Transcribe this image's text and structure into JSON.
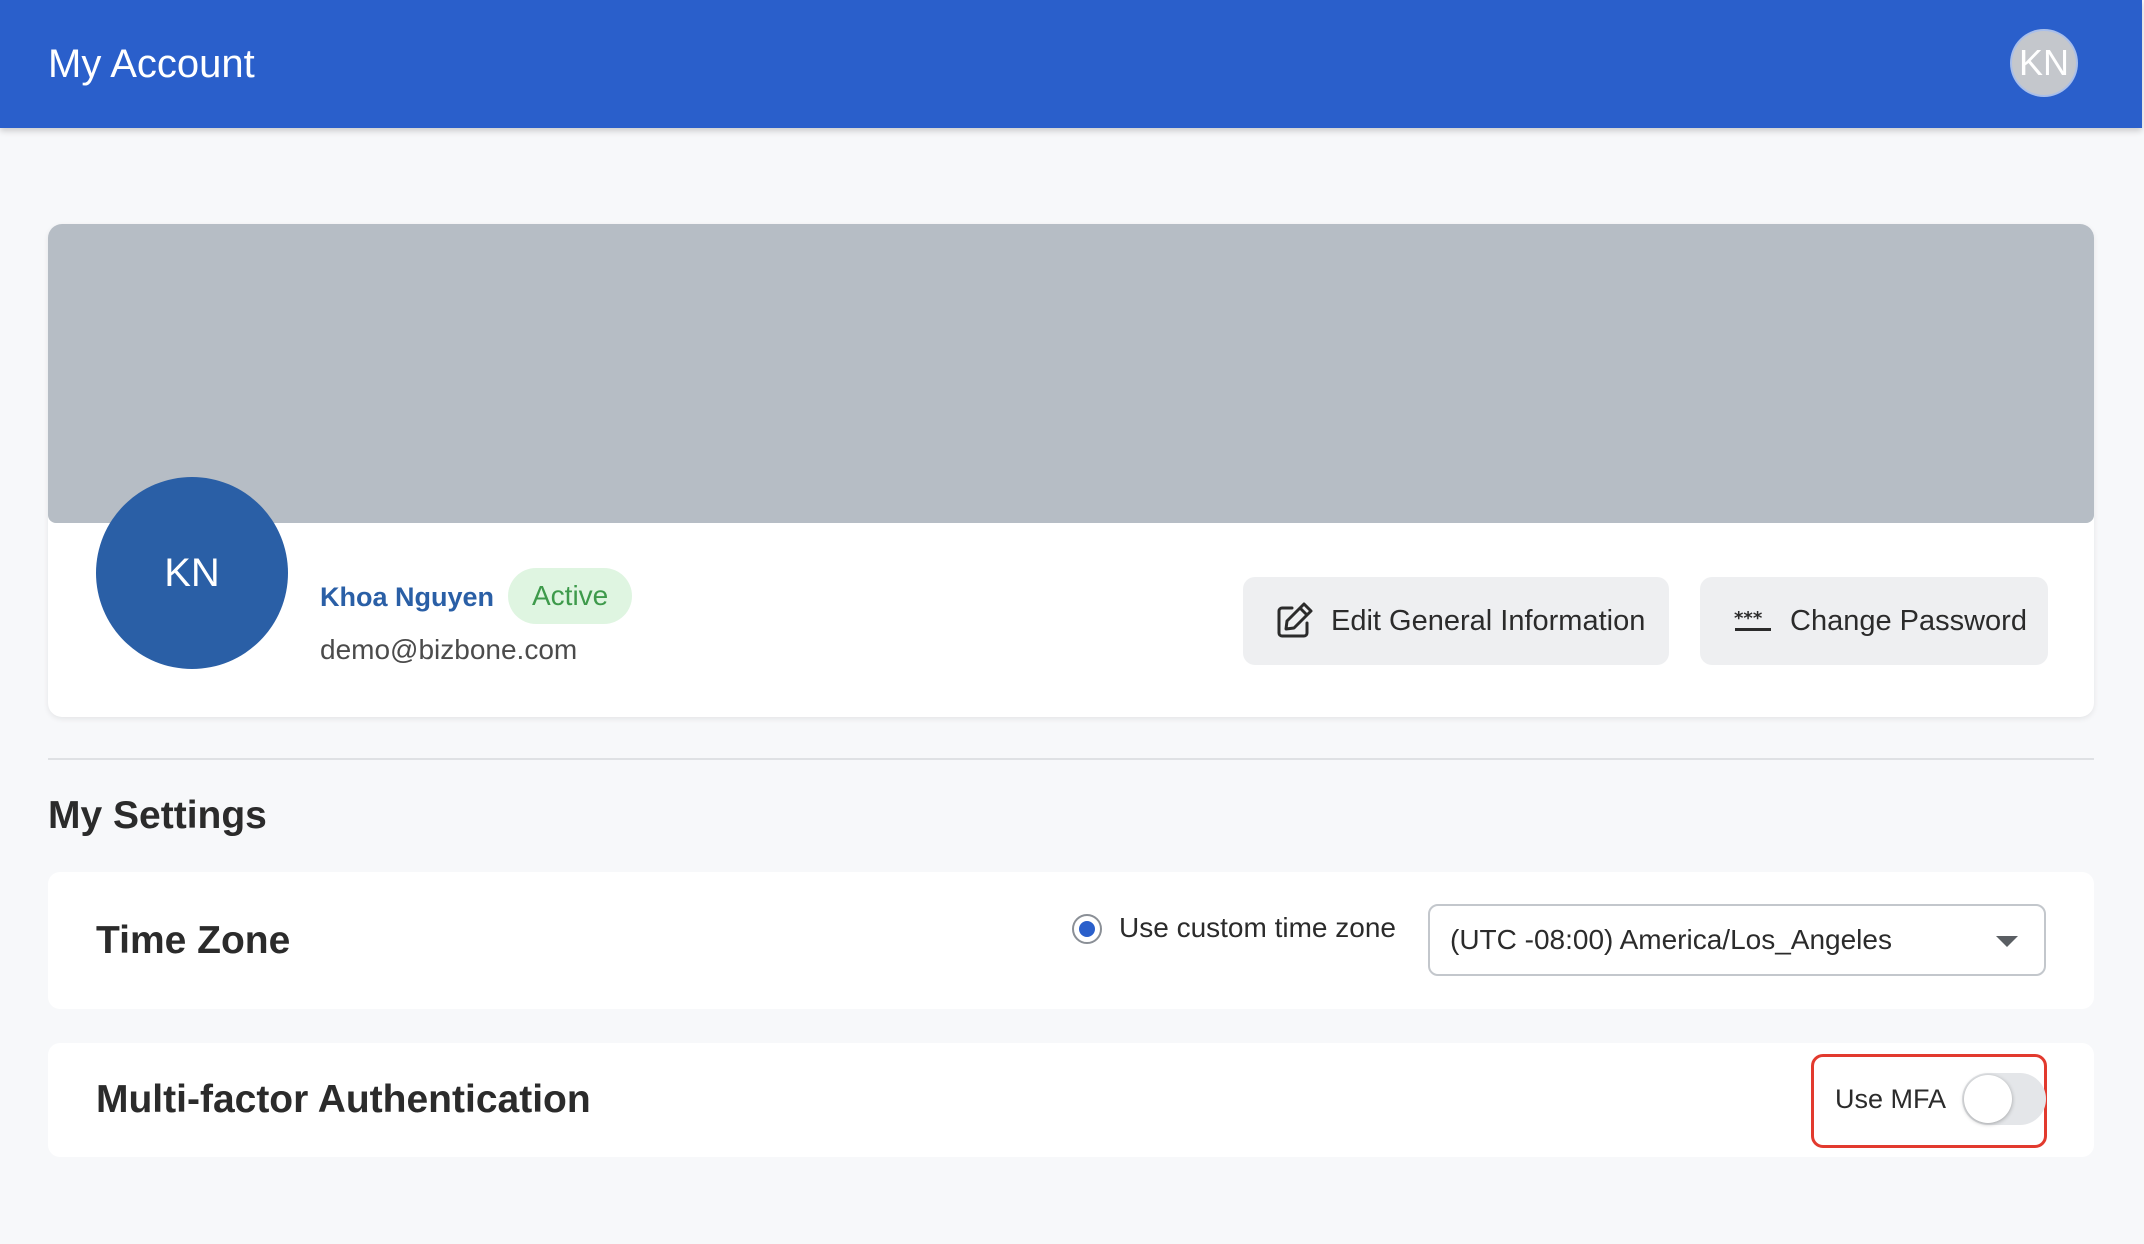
{
  "header": {
    "title": "My Account",
    "avatar_initials": "KN",
    "bar_color": "#2a5fcb"
  },
  "profile": {
    "avatar_initials": "KN",
    "name": "Khoa Nguyen",
    "status": "Active",
    "email": "demo@bizbone.com",
    "actions": {
      "edit_label": "Edit General Information",
      "edit_icon": "edit-icon",
      "password_label": "Change Password",
      "password_icon": "password-icon"
    }
  },
  "settings": {
    "heading": "My Settings",
    "time_zone": {
      "title": "Time Zone",
      "radio_label": "Use custom time zone",
      "radio_selected": true,
      "selected_value": "(UTC -08:00) America/Los_Angeles"
    },
    "mfa": {
      "title": "Multi-factor Authentication",
      "toggle_label": "Use MFA",
      "enabled": false,
      "highlight_color": "#e23a2e"
    }
  }
}
